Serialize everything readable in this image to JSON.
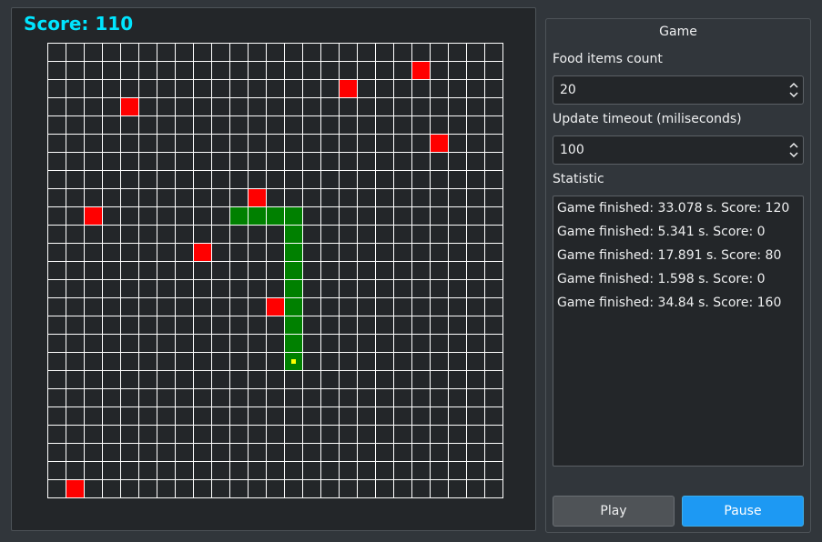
{
  "score_text": "Score: 110",
  "board": {
    "cols": 25,
    "rows": 25,
    "colors": {
      "background": "#232629",
      "grid": "#ffffff",
      "food": "#ff0000",
      "snake": "#008000",
      "head_marker": "#ffff00"
    },
    "food": [
      [
        20,
        1
      ],
      [
        16,
        2
      ],
      [
        4,
        3
      ],
      [
        21,
        5
      ],
      [
        11,
        8
      ],
      [
        2,
        9
      ],
      [
        8,
        11
      ],
      [
        12,
        14
      ],
      [
        1,
        24
      ]
    ],
    "snake": [
      [
        10,
        9
      ],
      [
        11,
        9
      ],
      [
        12,
        9
      ],
      [
        13,
        9
      ],
      [
        13,
        10
      ],
      [
        13,
        11
      ],
      [
        13,
        12
      ],
      [
        13,
        13
      ],
      [
        13,
        14
      ],
      [
        13,
        15
      ],
      [
        13,
        16
      ],
      [
        13,
        17
      ]
    ],
    "head": [
      13,
      17
    ]
  },
  "panel": {
    "title": "Game",
    "food_label": "Food items count",
    "food_value": "20",
    "timeout_label": "Update timeout (miliseconds)",
    "timeout_value": "100",
    "stats_label": "Statistic",
    "stats": [
      "Game finished: 33.078 s. Score: 120",
      "Game finished: 5.341 s. Score: 0",
      "Game finished: 17.891 s. Score: 80",
      "Game finished: 1.598 s. Score: 0",
      "Game finished: 34.84 s. Score: 160"
    ],
    "play_label": "Play",
    "pause_label": "Pause"
  }
}
